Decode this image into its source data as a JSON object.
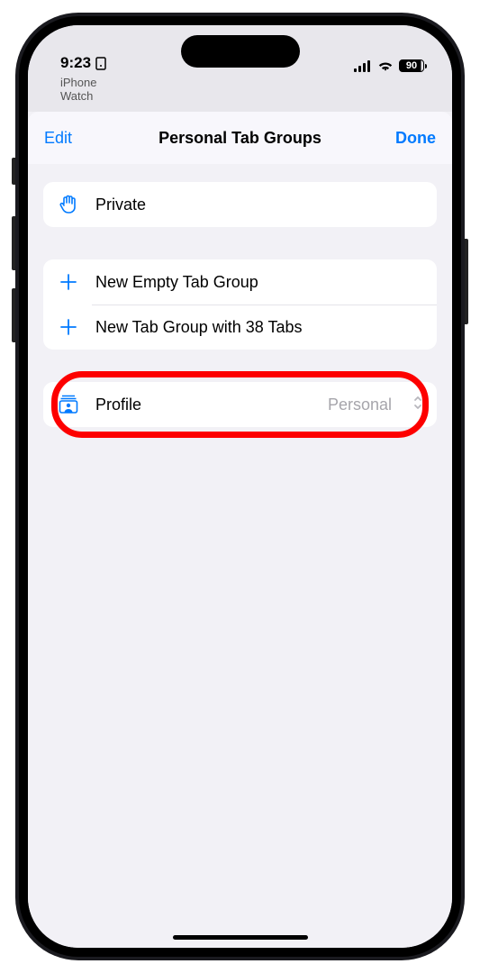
{
  "status": {
    "time": "9:23",
    "battery": "90"
  },
  "bg": {
    "line1": "iPhone",
    "line2": "Watch"
  },
  "sheet": {
    "edit": "Edit",
    "title": "Personal Tab Groups",
    "done": "Done"
  },
  "private": {
    "label": "Private"
  },
  "new": {
    "empty": "New Empty Tab Group",
    "withTabs": "New Tab Group with 38 Tabs"
  },
  "profile": {
    "label": "Profile",
    "value": "Personal"
  }
}
